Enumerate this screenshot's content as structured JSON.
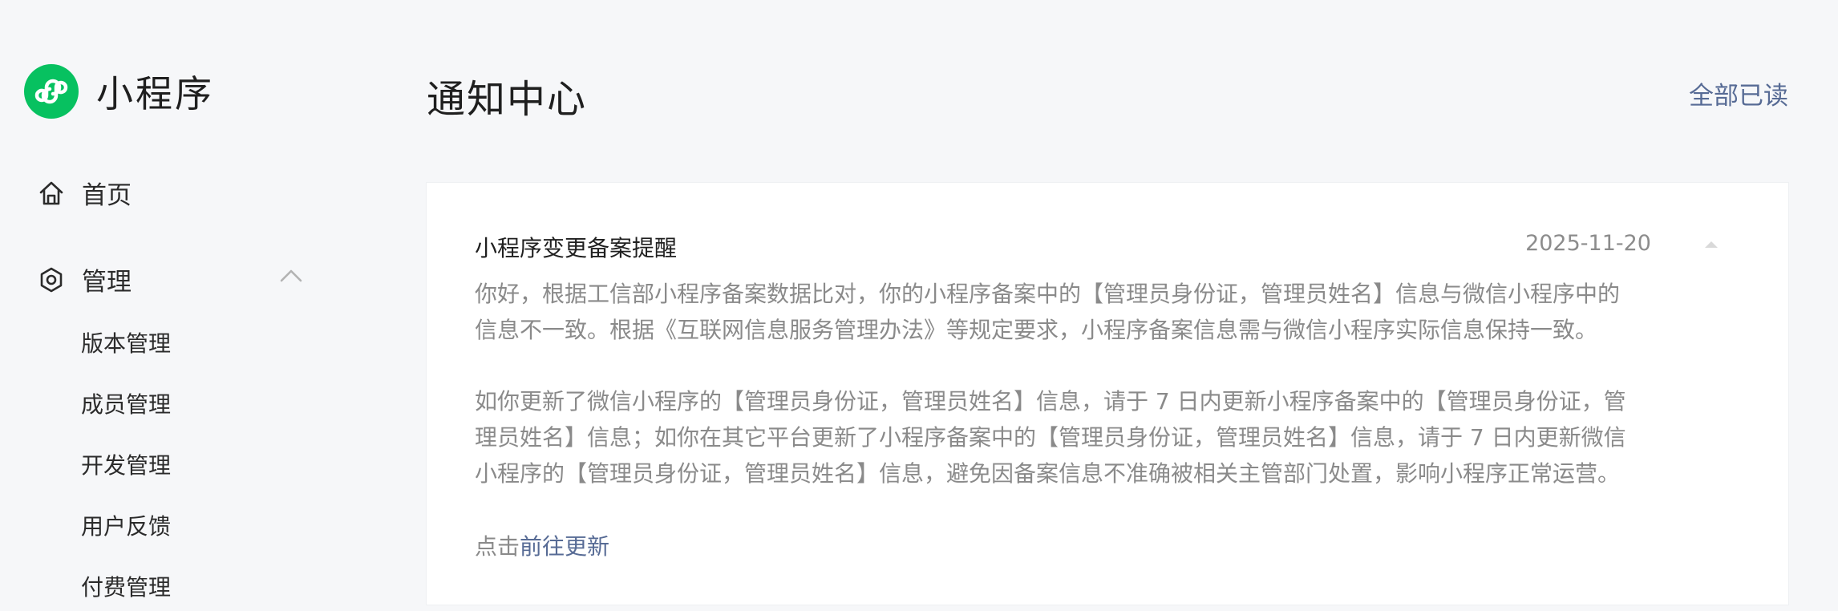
{
  "brand": {
    "title": "小程序",
    "logo_icon": "mini-program-logo-icon",
    "logo_color": "#07c160"
  },
  "sidebar": {
    "home": {
      "label": "首页",
      "icon": "home-icon"
    },
    "manage": {
      "label": "管理",
      "icon": "hexagon-settings-icon",
      "expanded": true
    },
    "sub_items": [
      {
        "label": "版本管理"
      },
      {
        "label": "成员管理"
      },
      {
        "label": "开发管理"
      },
      {
        "label": "用户反馈"
      },
      {
        "label": "付费管理"
      }
    ]
  },
  "header": {
    "title": "通知中心",
    "mark_all_read": "全部已读"
  },
  "notification": {
    "title": "小程序变更备案提醒",
    "date": "2025-11-20",
    "paragraph1": "你好，根据工信部小程序备案数据比对，你的小程序备案中的【管理员身份证，管理员姓名】信息与微信小程序中的信息不一致。根据《互联网信息服务管理办法》等规定要求，小程序备案信息需与微信小程序实际信息保持一致。",
    "paragraph2": "如你更新了微信小程序的【管理员身份证，管理员姓名】信息，请于 7 日内更新小程序备案中的【管理员身份证，管理员姓名】信息；如你在其它平台更新了小程序备案中的【管理员身份证，管理员姓名】信息，请于 7 日内更新微信小程序的【管理员身份证，管理员姓名】信息，避免因备案信息不准确被相关主管部门处置，影响小程序正常运营。",
    "cta_prefix": "点击",
    "cta_link": "前往更新"
  },
  "colors": {
    "accent": "#576b95",
    "background": "#f6f7f9"
  }
}
